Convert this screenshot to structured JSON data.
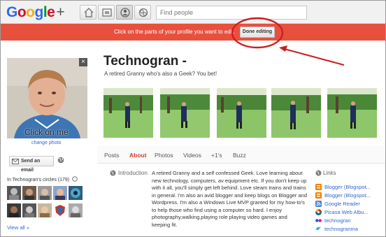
{
  "topbar": {
    "logo_google": "Google",
    "logo_plus": "+",
    "search_placeholder": "Find people"
  },
  "editbar": {
    "message": "Click on the parts of your profile you want to edit.",
    "done_label": "Done editing"
  },
  "profile": {
    "photo_overlay": "Click on me",
    "change_photo": "change photo",
    "close_label": "×",
    "send_email": "Send an email",
    "circles_title": "In Technogran's circles (179)",
    "view_all": "View all »"
  },
  "header": {
    "name": "Technogran -",
    "tagline": "A retired Granny who's also a Geek? You bet!"
  },
  "tabs": [
    {
      "label": "Posts"
    },
    {
      "label": "About"
    },
    {
      "label": "Photos"
    },
    {
      "label": "Videos"
    },
    {
      "label": "+1's"
    },
    {
      "label": "Buzz"
    }
  ],
  "about": {
    "intro_label": "Introduction",
    "intro_text": "A retired Granny and a self confessed Geek. Love learning about new technology, computers, av equipment etc. If you don't keep up with it all, you'll simply get left behind. Love steam trains and trains in general. I'm also an avid blogger and keep blogs on Blogger and Wordpress. I'm also a Windows Live MVP granted for my how-to's to help those who find using a computer so hard. I enjoy photography,walking,playing role playing video games and keeping fit.",
    "links_label": "Links",
    "links": [
      {
        "label": "Blogger (Blogspot...",
        "icon": "blogger-icon"
      },
      {
        "label": "Blogger (Blogspot...",
        "icon": "blogger-icon"
      },
      {
        "label": "Google Reader",
        "icon": "rss-icon"
      },
      {
        "label": "Picasa Web Albu...",
        "icon": "picasa-icon"
      },
      {
        "label": "technogran",
        "icon": "flickr-icon"
      },
      {
        "label": "technogranma",
        "icon": "twitter-icon"
      }
    ]
  },
  "colors": {
    "edit_bar": "#e8503e",
    "annotation": "#cc1f1f",
    "link": "#3366cc",
    "active_tab": "#d23f31"
  }
}
